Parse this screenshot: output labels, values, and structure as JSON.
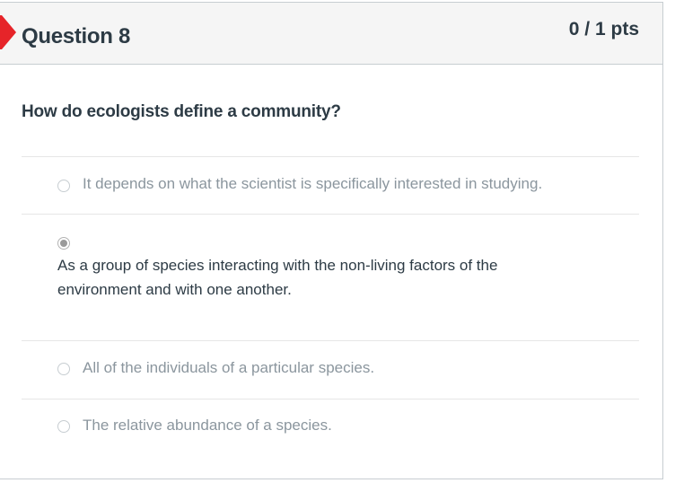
{
  "question": {
    "title": "Question 8",
    "points": "0 / 1 pts",
    "text": "How do ecologists define a community?",
    "answers": [
      {
        "label": "It depends on what the scientist is specifically interested in studying.",
        "selected": false
      },
      {
        "label": "As a group of species interacting with the non-living factors of the environment and with one another.",
        "selected": true
      },
      {
        "label": "All of the individuals of a particular species.",
        "selected": false
      },
      {
        "label": "The relative abundance of a species.",
        "selected": false
      }
    ]
  },
  "colors": {
    "flag": "#e62429",
    "text": "#2d3b45",
    "muted_text": "#8b969e",
    "header_bg": "#f5f5f5",
    "border": "#c7cdd1"
  }
}
